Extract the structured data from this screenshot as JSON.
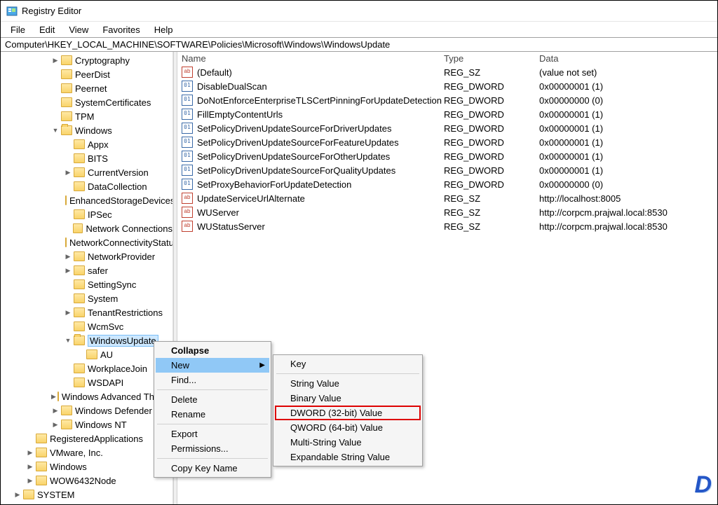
{
  "title": "Registry Editor",
  "menubar": [
    "File",
    "Edit",
    "View",
    "Favorites",
    "Help"
  ],
  "address": "Computer\\HKEY_LOCAL_MACHINE\\SOFTWARE\\Policies\\Microsoft\\Windows\\WindowsUpdate",
  "columns": {
    "name": "Name",
    "type": "Type",
    "data": "Data"
  },
  "values": [
    {
      "icon": "sz",
      "name": "(Default)",
      "type": "REG_SZ",
      "data": "(value not set)"
    },
    {
      "icon": "bin",
      "name": "DisableDualScan",
      "type": "REG_DWORD",
      "data": "0x00000001 (1)"
    },
    {
      "icon": "bin",
      "name": "DoNotEnforceEnterpriseTLSCertPinningForUpdateDetection",
      "type": "REG_DWORD",
      "data": "0x00000000 (0)"
    },
    {
      "icon": "bin",
      "name": "FillEmptyContentUrls",
      "type": "REG_DWORD",
      "data": "0x00000001 (1)"
    },
    {
      "icon": "bin",
      "name": "SetPolicyDrivenUpdateSourceForDriverUpdates",
      "type": "REG_DWORD",
      "data": "0x00000001 (1)"
    },
    {
      "icon": "bin",
      "name": "SetPolicyDrivenUpdateSourceForFeatureUpdates",
      "type": "REG_DWORD",
      "data": "0x00000001 (1)"
    },
    {
      "icon": "bin",
      "name": "SetPolicyDrivenUpdateSourceForOtherUpdates",
      "type": "REG_DWORD",
      "data": "0x00000001 (1)"
    },
    {
      "icon": "bin",
      "name": "SetPolicyDrivenUpdateSourceForQualityUpdates",
      "type": "REG_DWORD",
      "data": "0x00000001 (1)"
    },
    {
      "icon": "bin",
      "name": "SetProxyBehaviorForUpdateDetection",
      "type": "REG_DWORD",
      "data": "0x00000000 (0)"
    },
    {
      "icon": "sz",
      "name": "UpdateServiceUrlAlternate",
      "type": "REG_SZ",
      "data": "http://localhost:8005"
    },
    {
      "icon": "sz",
      "name": "WUServer",
      "type": "REG_SZ",
      "data": "http://corpcm.prajwal.local:8530"
    },
    {
      "icon": "sz",
      "name": "WUStatusServer",
      "type": "REG_SZ",
      "data": "http://corpcm.prajwal.local:8530"
    }
  ],
  "tree": [
    {
      "indent": 3,
      "expander": ">",
      "label": "Cryptography"
    },
    {
      "indent": 3,
      "expander": "",
      "label": "PeerDist"
    },
    {
      "indent": 3,
      "expander": "",
      "label": "Peernet"
    },
    {
      "indent": 3,
      "expander": "",
      "label": "SystemCertificates"
    },
    {
      "indent": 3,
      "expander": "",
      "label": "TPM"
    },
    {
      "indent": 3,
      "expander": "v",
      "label": "Windows"
    },
    {
      "indent": 4,
      "expander": "",
      "label": "Appx"
    },
    {
      "indent": 4,
      "expander": "",
      "label": "BITS"
    },
    {
      "indent": 4,
      "expander": ">",
      "label": "CurrentVersion"
    },
    {
      "indent": 4,
      "expander": "",
      "label": "DataCollection"
    },
    {
      "indent": 4,
      "expander": "",
      "label": "EnhancedStorageDevices"
    },
    {
      "indent": 4,
      "expander": "",
      "label": "IPSec"
    },
    {
      "indent": 4,
      "expander": "",
      "label": "Network Connections"
    },
    {
      "indent": 4,
      "expander": "",
      "label": "NetworkConnectivityStatusIndicator"
    },
    {
      "indent": 4,
      "expander": ">",
      "label": "NetworkProvider"
    },
    {
      "indent": 4,
      "expander": ">",
      "label": "safer"
    },
    {
      "indent": 4,
      "expander": "",
      "label": "SettingSync"
    },
    {
      "indent": 4,
      "expander": "",
      "label": "System"
    },
    {
      "indent": 4,
      "expander": ">",
      "label": "TenantRestrictions"
    },
    {
      "indent": 4,
      "expander": "",
      "label": "WcmSvc"
    },
    {
      "indent": 4,
      "expander": "v",
      "label": "WindowsUpdate",
      "selected": true
    },
    {
      "indent": 5,
      "expander": "",
      "label": "AU"
    },
    {
      "indent": 4,
      "expander": "",
      "label": "WorkplaceJoin"
    },
    {
      "indent": 4,
      "expander": "",
      "label": "WSDAPI"
    },
    {
      "indent": 3,
      "expander": ">",
      "label": "Windows Advanced Threat Protection"
    },
    {
      "indent": 3,
      "expander": ">",
      "label": "Windows Defender"
    },
    {
      "indent": 3,
      "expander": ">",
      "label": "Windows NT"
    },
    {
      "indent": 1,
      "expander": "",
      "label": "RegisteredApplications"
    },
    {
      "indent": 1,
      "expander": ">",
      "label": "VMware, Inc."
    },
    {
      "indent": 1,
      "expander": ">",
      "label": "Windows"
    },
    {
      "indent": 1,
      "expander": ">",
      "label": "WOW6432Node"
    },
    {
      "indent": 0,
      "expander": ">",
      "label": "SYSTEM"
    }
  ],
  "context_menu": {
    "items": [
      {
        "label": "Collapse",
        "bold": true
      },
      {
        "label": "New",
        "hover": true,
        "sub": true
      },
      {
        "label": "Find..."
      },
      {
        "sep": true
      },
      {
        "label": "Delete"
      },
      {
        "label": "Rename"
      },
      {
        "sep": true
      },
      {
        "label": "Export"
      },
      {
        "label": "Permissions..."
      },
      {
        "sep": true
      },
      {
        "label": "Copy Key Name"
      }
    ],
    "submenu": [
      {
        "label": "Key"
      },
      {
        "sep": true
      },
      {
        "label": "String Value"
      },
      {
        "label": "Binary Value"
      },
      {
        "label": "DWORD (32-bit) Value",
        "highlight": true
      },
      {
        "label": "QWORD (64-bit) Value"
      },
      {
        "label": "Multi-String Value"
      },
      {
        "label": "Expandable String Value"
      }
    ]
  },
  "watermark": "D"
}
